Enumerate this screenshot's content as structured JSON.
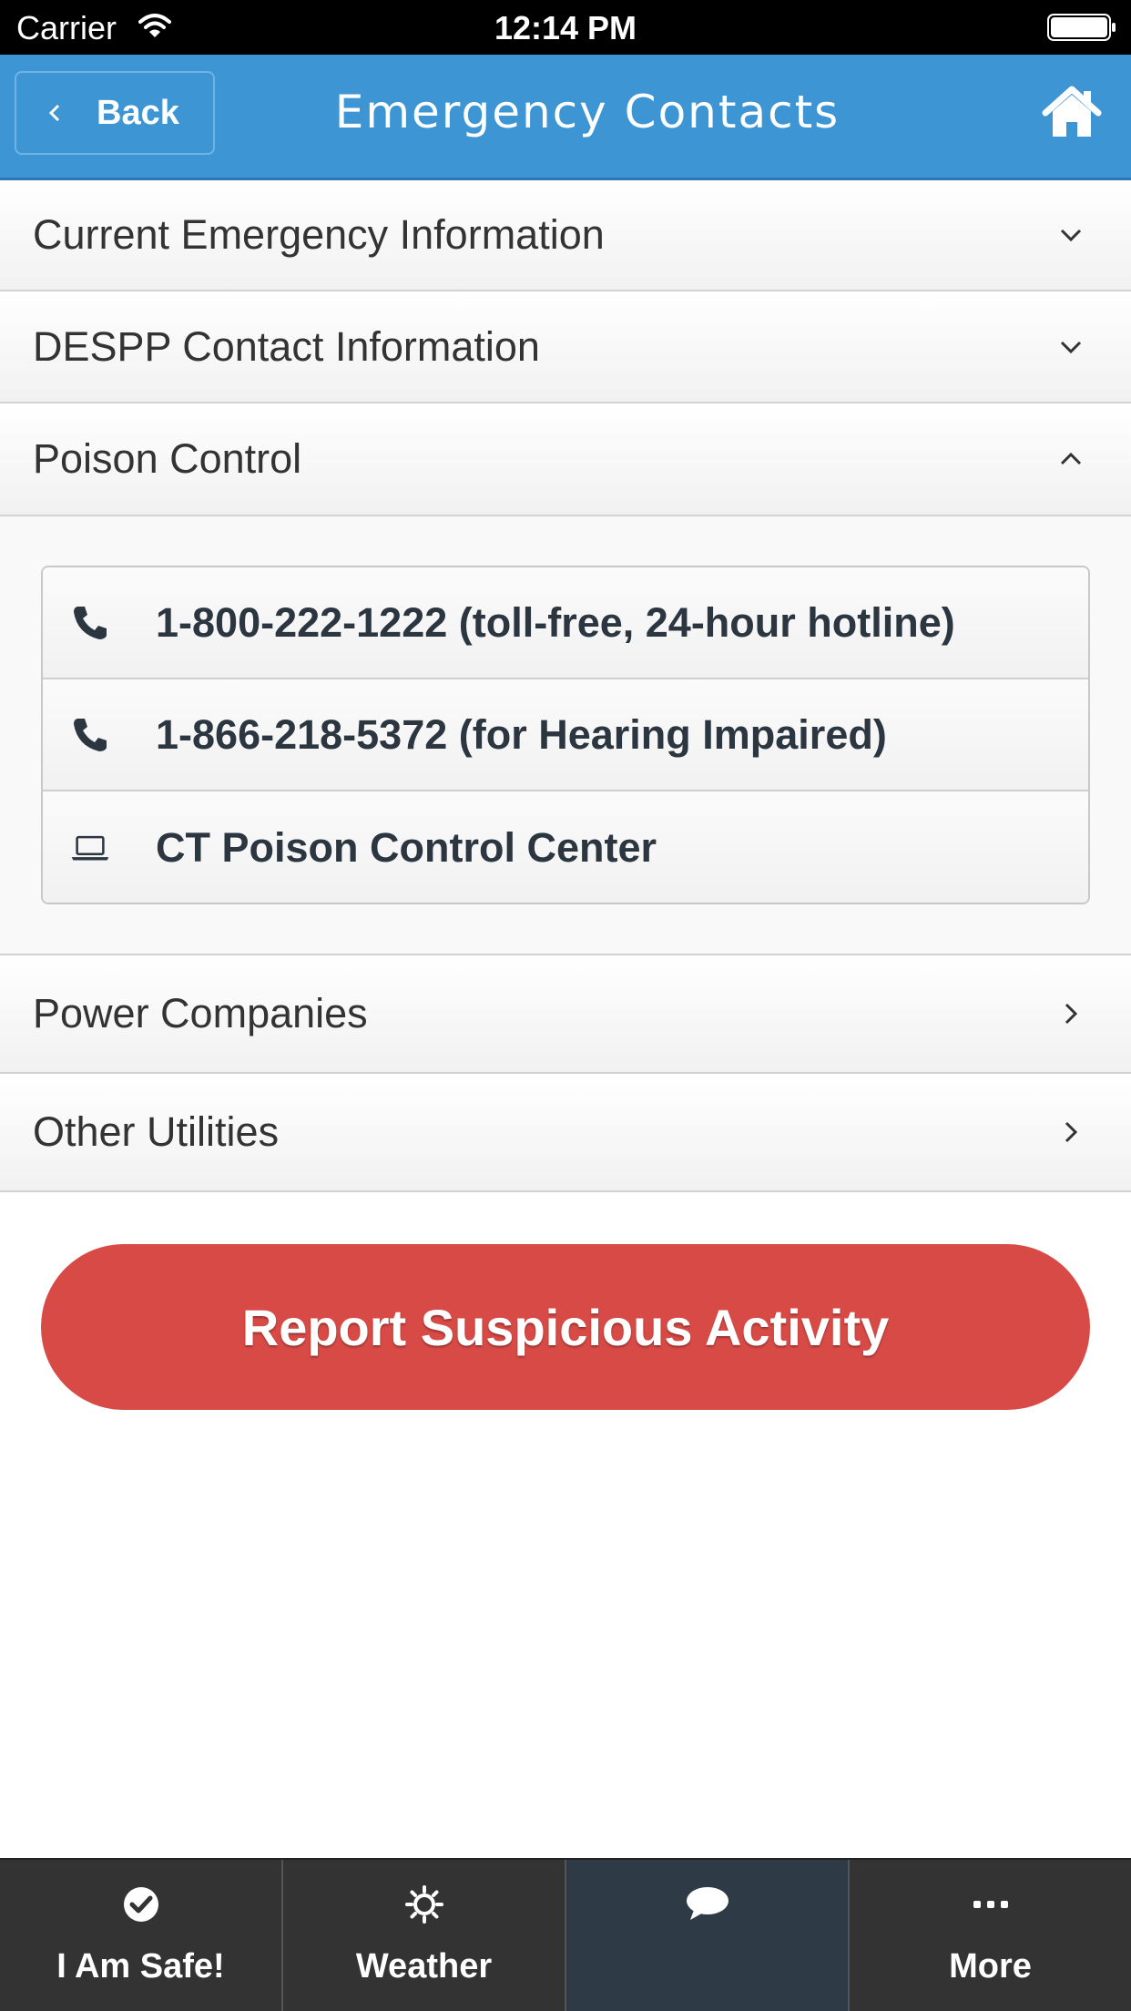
{
  "status_bar": {
    "carrier": "Carrier",
    "time": "12:14 PM"
  },
  "header": {
    "back_label": "Back",
    "title": "Emergency Contacts"
  },
  "accordion": [
    {
      "label": "Current Emergency Information",
      "state": "collapsed"
    },
    {
      "label": "DESPP Contact Information",
      "state": "collapsed"
    },
    {
      "label": "Poison Control",
      "state": "expanded"
    },
    {
      "label": "Power Companies",
      "state": "link"
    },
    {
      "label": "Other Utilities",
      "state": "link"
    }
  ],
  "poison_control": {
    "items": [
      {
        "icon": "phone-icon",
        "label": "1-800-222-1222 (toll-free, 24-hour hotline)"
      },
      {
        "icon": "phone-icon",
        "label": "1-866-218-5372 (for Hearing Impaired)"
      },
      {
        "icon": "laptop-icon",
        "label": "CT Poison Control Center"
      }
    ]
  },
  "report_button": {
    "label": "Report Suspicious Activity",
    "color": "#d84a46"
  },
  "tab_bar": {
    "tabs": [
      {
        "label": "I Am Safe!",
        "icon": "check-circle-icon"
      },
      {
        "label": "Weather",
        "icon": "sun-icon"
      },
      {
        "label": "",
        "icon": "chat-bubble-icon",
        "active": true
      },
      {
        "label": "More",
        "icon": "ellipsis-icon"
      }
    ]
  },
  "colors": {
    "header": "#3d95d3",
    "tab_bar": "#333333",
    "tab_active": "#2e3a46"
  }
}
